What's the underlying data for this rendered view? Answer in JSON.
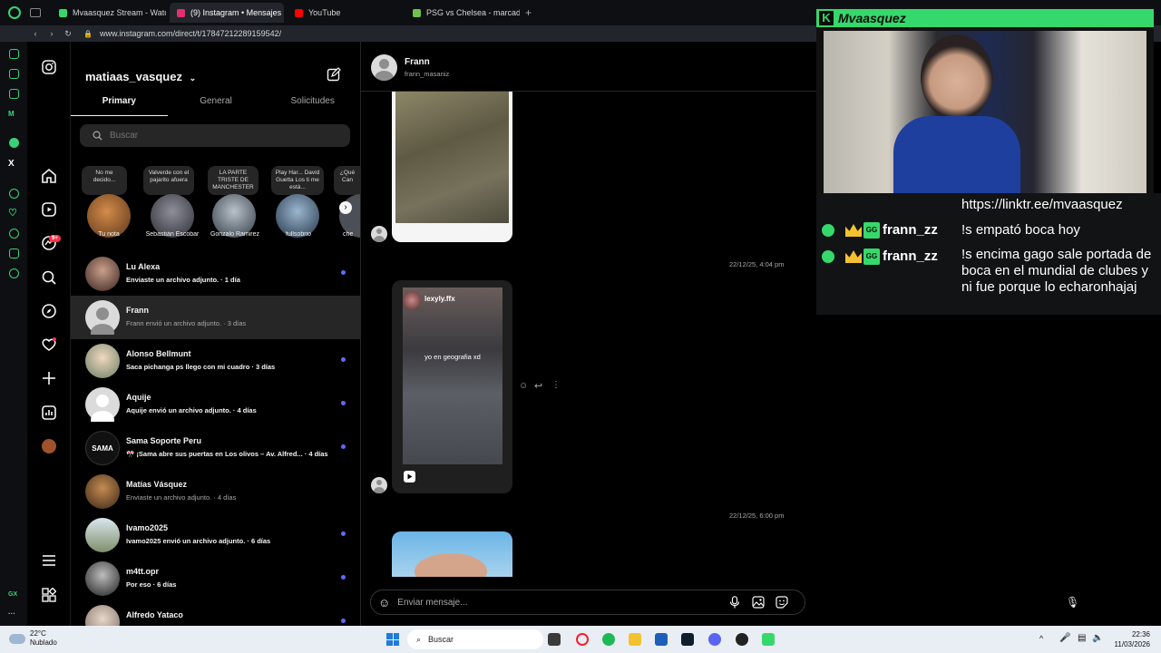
{
  "browser": {
    "tabs": [
      {
        "label": "Mvaasquez Stream - Watc",
        "fav_color": "#35d96b",
        "active": false
      },
      {
        "label": "(9) Instagram • Mensajes",
        "fav_color": "#e1306c",
        "active": true
      },
      {
        "label": "YouTube",
        "fav_color": "#ff0000",
        "active": false
      },
      {
        "label": "PSG vs Chelsea - marcado",
        "fav_color": "#6cc24a",
        "active": false
      }
    ],
    "add_tab": "+",
    "url": "www.instagram.com/direct/t/17847212289159542/"
  },
  "instagram": {
    "account_name": "matiaas_vasquez",
    "notifications_badge": "9+",
    "tabs": [
      "Primary",
      "General",
      "Solicitudes"
    ],
    "search_placeholder": "Buscar",
    "notes": [
      {
        "bubble": "No me decido...",
        "name": "Tu nota"
      },
      {
        "bubble": "Valverde con el pajarito afuera",
        "name": "Sebastián Escobar"
      },
      {
        "bubble": "LA PARTE TRISTE DE MANCHESTER",
        "name": "Gonzalo Ramirez"
      },
      {
        "bubble": "Play Har... David Guetta Los ti me está...",
        "name": "fullsobrio"
      },
      {
        "bubble": "¿Qué Can",
        "name": "che"
      }
    ],
    "conversations": [
      {
        "name": "Lu Alexa",
        "preview": "Enviaste un archivo adjunto. · 1 día",
        "unread": true
      },
      {
        "name": "Frann",
        "preview": "Frann envió un archivo adjunto. · 3 días",
        "unread": false,
        "active": true
      },
      {
        "name": "Alonso Bellmunt",
        "preview": "Saca pichanga ps llego con mi cuadro · 3 días",
        "unread": true
      },
      {
        "name": "Aquije",
        "preview": "Aquije envió un archivo adjunto. · 4 días",
        "unread": true
      },
      {
        "name": "Sama Soporte Peru",
        "preview": "🎌 ¡Sama abre sus puertas en Los olivos – Av. Alfred... · 4 días",
        "unread": true
      },
      {
        "name": "Matías Vásquez",
        "preview": "Enviaste un archivo adjunto. · 4 días",
        "unread": false
      },
      {
        "name": "Ivamo2025",
        "preview": "Ivamo2025 envió un archivo adjunto. · 6 días",
        "unread": true
      },
      {
        "name": "m4tt.opr",
        "preview": "Por eso · 6 días",
        "unread": true
      },
      {
        "name": "Alfredo Yataco",
        "preview": "",
        "unread": true
      }
    ],
    "chat": {
      "name": "Frann",
      "username": "frann_masaniz",
      "timestamps": [
        "22/12/25, 4:04 pm",
        "22/12/25, 6:00 pm"
      ],
      "reel_user": "lexyly.ffx",
      "reel_caption": "yo en geografia xd",
      "composer_placeholder": "Enviar mensaje..."
    }
  },
  "stream": {
    "channel": "Mvaasquez",
    "chat": [
      {
        "user": "",
        "text": "https://linktr.ee/mvaasquez"
      },
      {
        "user": "frann_zz",
        "text": "!s empató boca hoy"
      },
      {
        "user": "frann_zz",
        "text": "!s encima gago sale portada de boca en el mundial de clubes y ni fue porque lo echaronhajaj"
      }
    ]
  },
  "taskbar": {
    "weather_temp": "22°C",
    "weather_desc": "Nublado",
    "search": "Buscar",
    "time": "22:36",
    "date": "11/03/2026"
  }
}
